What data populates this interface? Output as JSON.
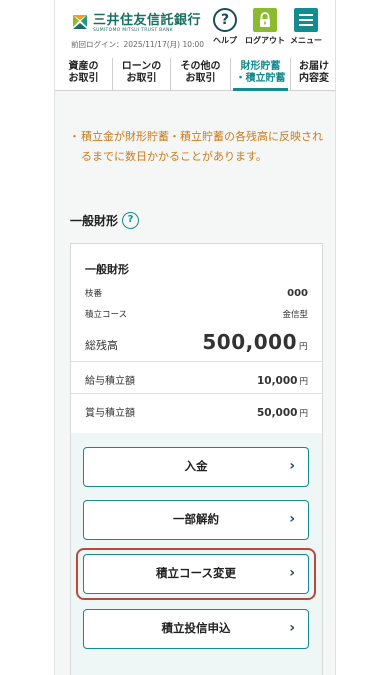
{
  "header": {
    "logo_ja": "三井住友信託銀行",
    "logo_en": "SUMITOMO MITSUI TRUST BANK",
    "last_login": "前回ログイン：2025/11/17(月) 10:00",
    "help_label": "ヘルプ",
    "logout_label": "ログアウト",
    "menu_label": "メニュー"
  },
  "tabs": [
    {
      "line1": "資産の",
      "line2": "お取引",
      "active": false
    },
    {
      "line1": "ローンの",
      "line2": "お取引",
      "active": false
    },
    {
      "line1": "その他の",
      "line2": "お取引",
      "active": false
    },
    {
      "line1": "財形貯蓄",
      "line2": "・積立貯蓄",
      "active": true
    },
    {
      "line1": "お届け",
      "line2": "内容変",
      "active": false
    }
  ],
  "note": {
    "bullet": "・",
    "text": "積立金が財形貯蓄・積立貯蓄の各残高に反映されるまでに数日かかることがあります。"
  },
  "section": {
    "title": "一般財形",
    "help_icon": "?"
  },
  "account": {
    "title": "一般財形",
    "branch_label": "枝番",
    "branch_value": "000",
    "course_label": "積立コース",
    "course_value": "金信型",
    "balance_label": "総残高",
    "balance_value": "500,000",
    "balance_unit": "円",
    "salary_label": "給与積立額",
    "salary_value": "10,000",
    "salary_unit": "円",
    "bonus_label": "賞与積立額",
    "bonus_value": "50,000",
    "bonus_unit": "円"
  },
  "actions": {
    "deposit": "入金",
    "partial_withdraw": "一部解約",
    "change_course": "積立コース変更",
    "fund_apply": "積立投信申込",
    "chevron": "›"
  },
  "colors": {
    "brand_teal": "#148b8f",
    "note_orange": "#c97b1a",
    "highlight_red": "#b84a3d",
    "logout_green": "#8dbb2f"
  }
}
